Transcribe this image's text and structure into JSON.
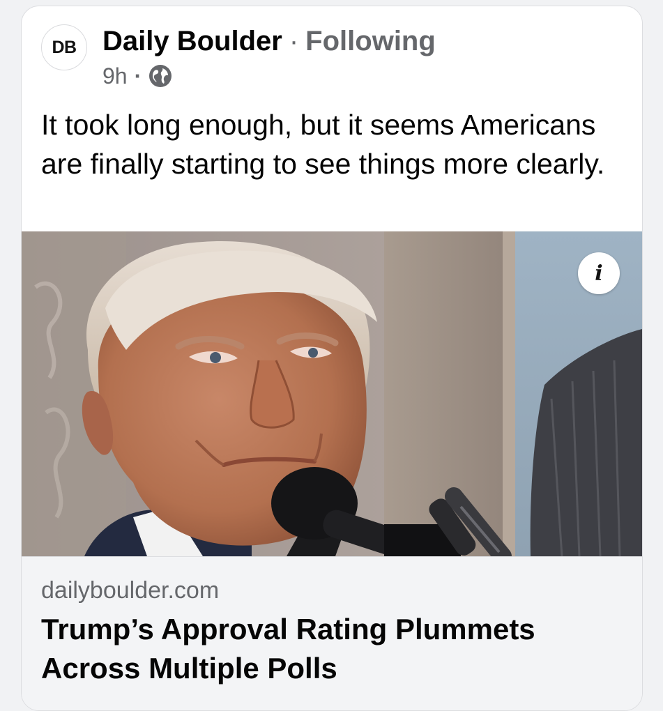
{
  "post": {
    "avatar_initials": "DB",
    "page_name": "Daily Boulder",
    "separator": "·",
    "follow_status": "Following",
    "time_ago": "9h",
    "meta_separator": "·",
    "audience_icon": "globe-icon",
    "text": "It took long enough, but it seems Americans are finally starting to see things more clearly."
  },
  "media": {
    "info_icon": "info-icon",
    "info_label": "i"
  },
  "link_preview": {
    "domain": "dailyboulder.com",
    "title": "Trump’s Approval Rating Plummets Across Multiple Polls"
  },
  "colors": {
    "primary_text": "#050505",
    "secondary_text": "#65676b",
    "card_background": "#ffffff",
    "footer_background": "#f3f4f6"
  }
}
